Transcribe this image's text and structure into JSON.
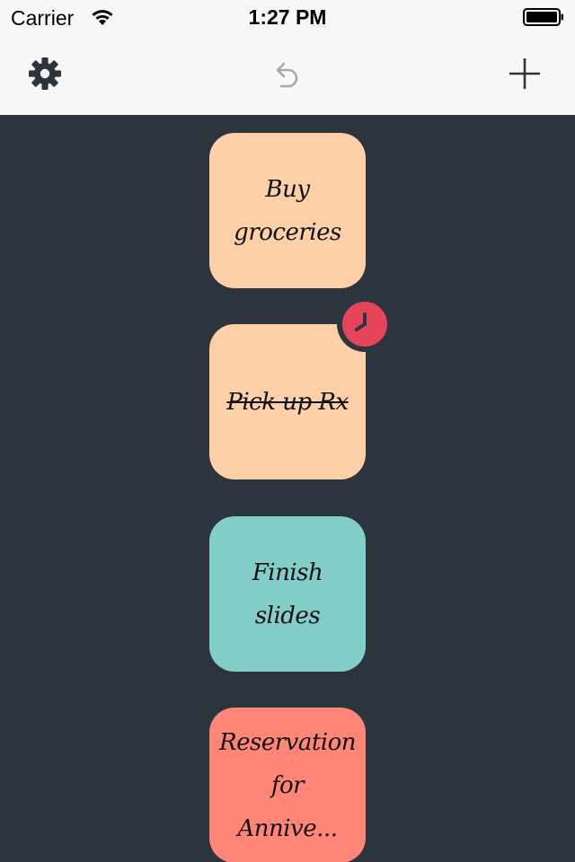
{
  "statusbar": {
    "carrier": "Carrier",
    "time": "1:27 PM",
    "wifi_icon": "wifi-icon",
    "battery_icon": "battery-icon"
  },
  "toolbar": {
    "settings_icon": "gear-icon",
    "undo_icon": "undo-icon",
    "add_icon": "plus-icon"
  },
  "colors": {
    "background": "#2c353d",
    "bar": "#f7f7f7",
    "card_peach": "#fdd0a7",
    "card_teal": "#84ceca",
    "card_salmon": "#ff8677",
    "badge_red": "#e5445a",
    "icon_dark": "#2c353d",
    "icon_disabled": "#a8a8a8"
  },
  "tasks": [
    {
      "text": "Buy groceries",
      "color": "#fdd0a7",
      "done": false,
      "reminder": false
    },
    {
      "text": "Pick up Rx",
      "color": "#fdd0a7",
      "done": true,
      "reminder": true,
      "reminder_icon": "clock-icon"
    },
    {
      "text": "Finish slides",
      "color": "#84ceca",
      "done": false,
      "reminder": false
    },
    {
      "text": "Reservation for Annive...",
      "color": "#ff8677",
      "done": false,
      "reminder": false
    }
  ]
}
